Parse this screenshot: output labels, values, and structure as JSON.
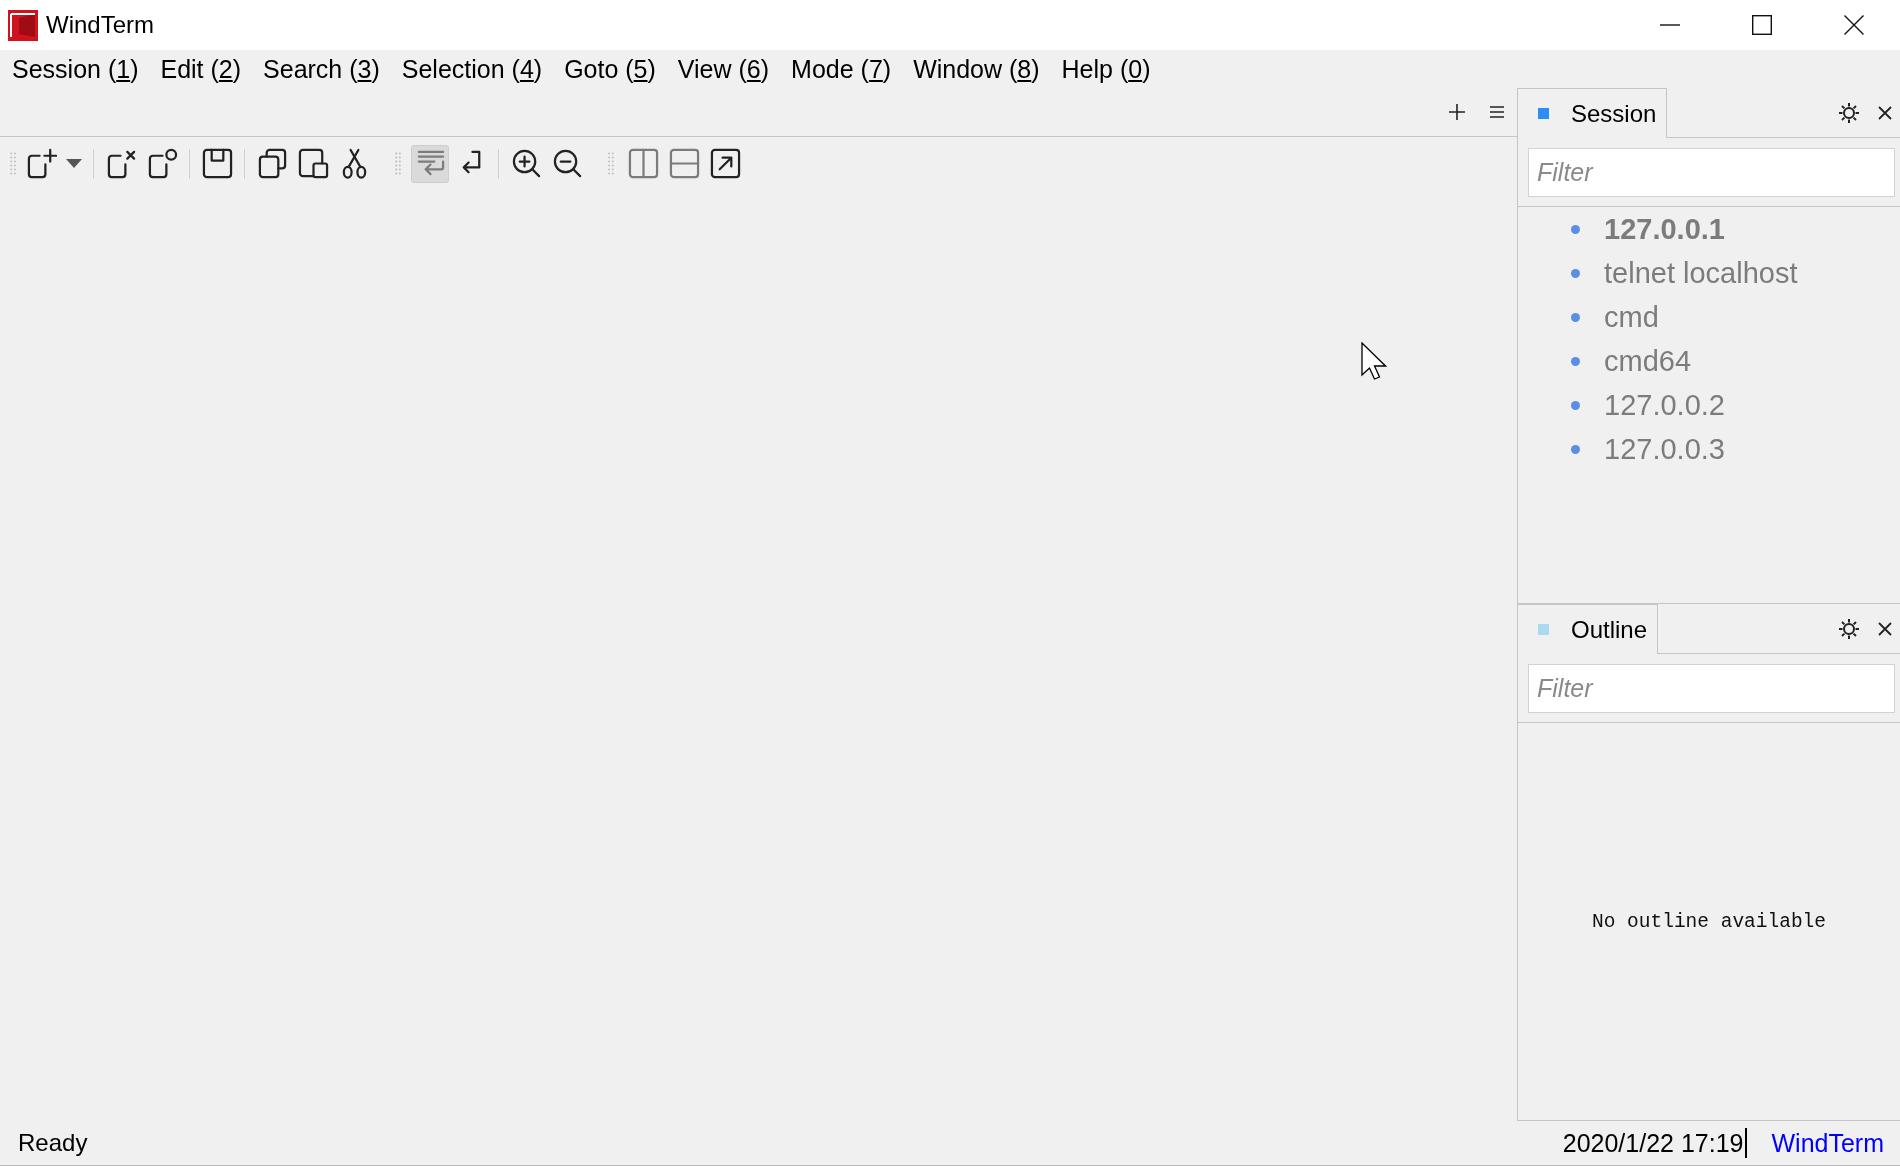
{
  "window": {
    "title": "WindTerm"
  },
  "menu": [
    {
      "before": "Session (",
      "mnemonic": "1",
      "after": ")"
    },
    {
      "before": "Edit (",
      "mnemonic": "2",
      "after": ")"
    },
    {
      "before": "Search (",
      "mnemonic": "3",
      "after": ")"
    },
    {
      "before": "Selection (",
      "mnemonic": "4",
      "after": ")"
    },
    {
      "before": "Goto (",
      "mnemonic": "5",
      "after": ")"
    },
    {
      "before": "View (",
      "mnemonic": "6",
      "after": ")"
    },
    {
      "before": "Mode (",
      "mnemonic": "7",
      "after": ")"
    },
    {
      "before": "Window (",
      "mnemonic": "8",
      "after": ")"
    },
    {
      "before": "Help (",
      "mnemonic": "0",
      "after": ")"
    }
  ],
  "toolbar": {
    "buttons": [
      {
        "pressed": false,
        "disabled": false
      },
      {
        "pressed": false,
        "disabled": false
      },
      {
        "pressed": false,
        "disabled": false
      },
      {
        "pressed": false,
        "disabled": false
      },
      {
        "pressed": false,
        "disabled": false
      },
      {
        "pressed": false,
        "disabled": false
      },
      {
        "pressed": false,
        "disabled": false
      },
      {
        "pressed": false,
        "disabled": false
      },
      {
        "pressed": true,
        "disabled": true
      },
      {
        "pressed": false,
        "disabled": false
      },
      {
        "pressed": false,
        "disabled": false
      },
      {
        "pressed": false,
        "disabled": false
      },
      {
        "pressed": false,
        "disabled": true
      },
      {
        "pressed": false,
        "disabled": true
      },
      {
        "pressed": false,
        "disabled": false
      }
    ]
  },
  "session_panel": {
    "title": "Session",
    "focused": true,
    "filter": {
      "placeholder": "Filter"
    },
    "items": [
      {
        "label": "127.0.0.1",
        "active": true
      },
      {
        "label": "telnet localhost",
        "active": false
      },
      {
        "label": "cmd",
        "active": false
      },
      {
        "label": "cmd64",
        "active": false
      },
      {
        "label": "127.0.0.2",
        "active": false
      },
      {
        "label": "127.0.0.3",
        "active": false
      }
    ]
  },
  "outline_panel": {
    "title": "Outline",
    "focused": false,
    "filter": {
      "placeholder": "Filter"
    },
    "empty_message": "No outline available"
  },
  "status_bar": {
    "message": "Ready",
    "datetime": "2020/1/22 17:19",
    "app_name": "WindTerm"
  }
}
